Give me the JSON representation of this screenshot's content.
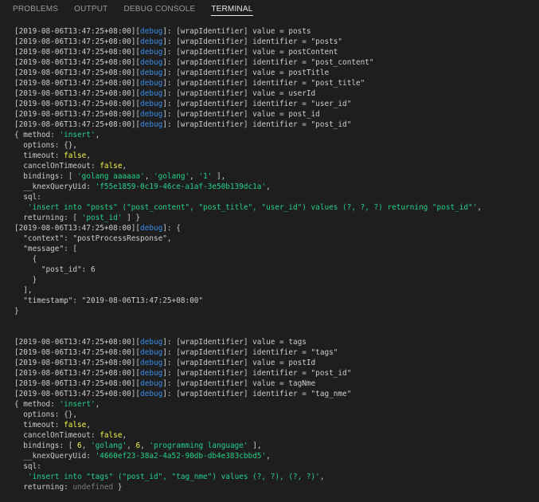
{
  "panel": {
    "tabs": [
      {
        "label": "PROBLEMS",
        "active": false
      },
      {
        "label": "OUTPUT",
        "active": false
      },
      {
        "label": "DEBUG CONSOLE",
        "active": false
      },
      {
        "label": "TERMINAL",
        "active": true
      }
    ]
  },
  "colors": {
    "background": "#1e1e1e",
    "text": "#cccccc",
    "blue": "#3b8eea",
    "green": "#23d18b",
    "yellow": "#f5f543",
    "gray": "#7a7a7a"
  },
  "terminal": {
    "lines": [
      [
        {
          "t": "[2019-08-06T13:47:25+08:00]["
        },
        {
          "t": "debug",
          "c": "blue"
        },
        {
          "t": "]: [wrapIdentifier] value = posts"
        }
      ],
      [
        {
          "t": "[2019-08-06T13:47:25+08:00]["
        },
        {
          "t": "debug",
          "c": "blue"
        },
        {
          "t": "]: [wrapIdentifier] identifier = \"posts\""
        }
      ],
      [
        {
          "t": "[2019-08-06T13:47:25+08:00]["
        },
        {
          "t": "debug",
          "c": "blue"
        },
        {
          "t": "]: [wrapIdentifier] value = postContent"
        }
      ],
      [
        {
          "t": "[2019-08-06T13:47:25+08:00]["
        },
        {
          "t": "debug",
          "c": "blue"
        },
        {
          "t": "]: [wrapIdentifier] identifier = \"post_content\""
        }
      ],
      [
        {
          "t": "[2019-08-06T13:47:25+08:00]["
        },
        {
          "t": "debug",
          "c": "blue"
        },
        {
          "t": "]: [wrapIdentifier] value = postTitle"
        }
      ],
      [
        {
          "t": "[2019-08-06T13:47:25+08:00]["
        },
        {
          "t": "debug",
          "c": "blue"
        },
        {
          "t": "]: [wrapIdentifier] identifier = \"post_title\""
        }
      ],
      [
        {
          "t": "[2019-08-06T13:47:25+08:00]["
        },
        {
          "t": "debug",
          "c": "blue"
        },
        {
          "t": "]: [wrapIdentifier] value = userId"
        }
      ],
      [
        {
          "t": "[2019-08-06T13:47:25+08:00]["
        },
        {
          "t": "debug",
          "c": "blue"
        },
        {
          "t": "]: [wrapIdentifier] identifier = \"user_id\""
        }
      ],
      [
        {
          "t": "[2019-08-06T13:47:25+08:00]["
        },
        {
          "t": "debug",
          "c": "blue"
        },
        {
          "t": "]: [wrapIdentifier] value = post_id"
        }
      ],
      [
        {
          "t": "[2019-08-06T13:47:25+08:00]["
        },
        {
          "t": "debug",
          "c": "blue"
        },
        {
          "t": "]: [wrapIdentifier] identifier = \"post_id\""
        }
      ],
      [
        {
          "t": "{ method: "
        },
        {
          "t": "'insert'",
          "c": "green"
        },
        {
          "t": ","
        }
      ],
      [
        {
          "t": "  options: {},"
        }
      ],
      [
        {
          "t": "  timeout: "
        },
        {
          "t": "false",
          "c": "yellow"
        },
        {
          "t": ","
        }
      ],
      [
        {
          "t": "  cancelOnTimeout: "
        },
        {
          "t": "false",
          "c": "yellow"
        },
        {
          "t": ","
        }
      ],
      [
        {
          "t": "  bindings: [ "
        },
        {
          "t": "'golang aaaaaa'",
          "c": "green"
        },
        {
          "t": ", "
        },
        {
          "t": "'golang'",
          "c": "green"
        },
        {
          "t": ", "
        },
        {
          "t": "'1'",
          "c": "green"
        },
        {
          "t": " ],"
        }
      ],
      [
        {
          "t": "  __knexQueryUid: "
        },
        {
          "t": "'f55e1859-0c19-46ce-a1af-3e50b139dc1a'",
          "c": "green"
        },
        {
          "t": ","
        }
      ],
      [
        {
          "t": "  sql:"
        }
      ],
      [
        {
          "t": "   "
        },
        {
          "t": "'insert into \"posts\" (\"post_content\", \"post_title\", \"user_id\") values (?, ?, ?) returning \"post_id\"'",
          "c": "green"
        },
        {
          "t": ","
        }
      ],
      [
        {
          "t": "  returning: [ "
        },
        {
          "t": "'post_id'",
          "c": "green"
        },
        {
          "t": " ] }"
        }
      ],
      [
        {
          "t": "[2019-08-06T13:47:25+08:00]["
        },
        {
          "t": "debug",
          "c": "blue"
        },
        {
          "t": "]: {"
        }
      ],
      [
        {
          "t": "  \"context\": \"postProcessResponse\","
        }
      ],
      [
        {
          "t": "  \"message\": ["
        }
      ],
      [
        {
          "t": "    {"
        }
      ],
      [
        {
          "t": "      \"post_id\": 6"
        }
      ],
      [
        {
          "t": "    }"
        }
      ],
      [
        {
          "t": "  ],"
        }
      ],
      [
        {
          "t": "  \"timestamp\": \"2019-08-06T13:47:25+08:00\""
        }
      ],
      [
        {
          "t": "}"
        }
      ],
      [],
      [],
      [
        {
          "t": "[2019-08-06T13:47:25+08:00]["
        },
        {
          "t": "debug",
          "c": "blue"
        },
        {
          "t": "]: [wrapIdentifier] value = tags"
        }
      ],
      [
        {
          "t": "[2019-08-06T13:47:25+08:00]["
        },
        {
          "t": "debug",
          "c": "blue"
        },
        {
          "t": "]: [wrapIdentifier] identifier = \"tags\""
        }
      ],
      [
        {
          "t": "[2019-08-06T13:47:25+08:00]["
        },
        {
          "t": "debug",
          "c": "blue"
        },
        {
          "t": "]: [wrapIdentifier] value = postId"
        }
      ],
      [
        {
          "t": "[2019-08-06T13:47:25+08:00]["
        },
        {
          "t": "debug",
          "c": "blue"
        },
        {
          "t": "]: [wrapIdentifier] identifier = \"post_id\""
        }
      ],
      [
        {
          "t": "[2019-08-06T13:47:25+08:00]["
        },
        {
          "t": "debug",
          "c": "blue"
        },
        {
          "t": "]: [wrapIdentifier] value = tagNme"
        }
      ],
      [
        {
          "t": "[2019-08-06T13:47:25+08:00]["
        },
        {
          "t": "debug",
          "c": "blue"
        },
        {
          "t": "]: [wrapIdentifier] identifier = \"tag_nme\""
        }
      ],
      [
        {
          "t": "{ method: "
        },
        {
          "t": "'insert'",
          "c": "green"
        },
        {
          "t": ","
        }
      ],
      [
        {
          "t": "  options: {},"
        }
      ],
      [
        {
          "t": "  timeout: "
        },
        {
          "t": "false",
          "c": "yellow"
        },
        {
          "t": ","
        }
      ],
      [
        {
          "t": "  cancelOnTimeout: "
        },
        {
          "t": "false",
          "c": "yellow"
        },
        {
          "t": ","
        }
      ],
      [
        {
          "t": "  bindings: [ "
        },
        {
          "t": "6",
          "c": "yellow"
        },
        {
          "t": ", "
        },
        {
          "t": "'golang'",
          "c": "green"
        },
        {
          "t": ", "
        },
        {
          "t": "6",
          "c": "yellow"
        },
        {
          "t": ", "
        },
        {
          "t": "'programming language'",
          "c": "green"
        },
        {
          "t": " ],"
        }
      ],
      [
        {
          "t": "  __knexQueryUid: "
        },
        {
          "t": "'4660ef23-38a2-4a52-90db-db4e383cbbd5'",
          "c": "green"
        },
        {
          "t": ","
        }
      ],
      [
        {
          "t": "  sql:"
        }
      ],
      [
        {
          "t": "   "
        },
        {
          "t": "'insert into \"tags\" (\"post_id\", \"tag_nme\") values (?, ?), (?, ?)'",
          "c": "green"
        },
        {
          "t": ","
        }
      ],
      [
        {
          "t": "  returning: "
        },
        {
          "t": "undefined",
          "c": "gray"
        },
        {
          "t": " }"
        }
      ]
    ]
  }
}
